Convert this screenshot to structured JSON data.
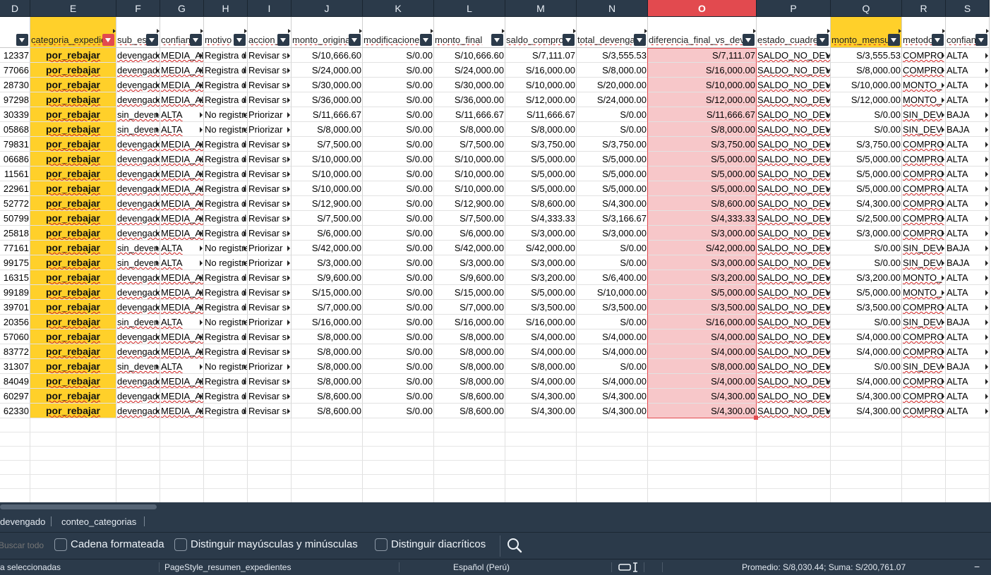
{
  "columns": [
    {
      "letter": "D",
      "header": "",
      "kind": "id",
      "selected": false,
      "highlight": ""
    },
    {
      "letter": "E",
      "header": "categoria_expediente",
      "kind": "cat",
      "selected": false,
      "highlight": "yellow",
      "filter_active": true
    },
    {
      "letter": "F",
      "header": "sub_estado",
      "kind": "text",
      "selected": false,
      "highlight": ""
    },
    {
      "letter": "G",
      "header": "confianza",
      "kind": "text",
      "selected": false,
      "highlight": ""
    },
    {
      "letter": "H",
      "header": "motivo",
      "kind": "text",
      "selected": false,
      "highlight": ""
    },
    {
      "letter": "I",
      "header": "accion_sugerida",
      "kind": "text",
      "selected": false,
      "highlight": ""
    },
    {
      "letter": "J",
      "header": "monto_original",
      "kind": "num",
      "selected": false,
      "highlight": ""
    },
    {
      "letter": "K",
      "header": "modificaciones",
      "kind": "num",
      "selected": false,
      "highlight": ""
    },
    {
      "letter": "L",
      "header": "monto_final",
      "kind": "num",
      "selected": false,
      "highlight": ""
    },
    {
      "letter": "M",
      "header": "saldo_comprometido",
      "kind": "num",
      "selected": false,
      "highlight": ""
    },
    {
      "letter": "N",
      "header": "total_devengado",
      "kind": "num",
      "selected": false,
      "highlight": ""
    },
    {
      "letter": "O",
      "header": "diferencia_final_vs_devengado",
      "kind": "num",
      "selected": true,
      "highlight": "pink"
    },
    {
      "letter": "P",
      "header": "estado_cuadre",
      "kind": "text",
      "selected": false,
      "highlight": ""
    },
    {
      "letter": "Q",
      "header": "monto_mensual",
      "kind": "num",
      "selected": false,
      "highlight": "yellow-header"
    },
    {
      "letter": "R",
      "header": "metodo",
      "kind": "text",
      "selected": false,
      "highlight": ""
    },
    {
      "letter": "S",
      "header": "confianza",
      "kind": "text",
      "selected": false,
      "highlight": ""
    }
  ],
  "rows": [
    [
      "12337",
      "por_rebajar",
      "devengado",
      "MEDIA_ALTA",
      "Registra d",
      "Revisar s",
      "S/10,666.60",
      "S/0.00",
      "S/10,666.60",
      "S/7,111.07",
      "S/3,555.53",
      "S/7,111.07",
      "SALDO_NO_DEV",
      "S/3,555.53",
      "COMPRO",
      "ALTA"
    ],
    [
      "77066",
      "por_rebajar",
      "devengado",
      "MEDIA_ALTA",
      "Registra d",
      "Revisar s",
      "S/24,000.00",
      "S/0.00",
      "S/24,000.00",
      "S/16,000.00",
      "S/8,000.00",
      "S/16,000.00",
      "SALDO_NO_DEV",
      "S/8,000.00",
      "COMPRO",
      "ALTA"
    ],
    [
      "28730",
      "por_rebajar",
      "devengado",
      "MEDIA_ALTA",
      "Registra d",
      "Revisar s",
      "S/30,000.00",
      "S/0.00",
      "S/30,000.00",
      "S/10,000.00",
      "S/20,000.00",
      "S/10,000.00",
      "SALDO_NO_DEV",
      "S/10,000.00",
      "MONTO_",
      "ALTA"
    ],
    [
      "97298",
      "por_rebajar",
      "devengado",
      "MEDIA_ALTA",
      "Registra d",
      "Revisar s",
      "S/36,000.00",
      "S/0.00",
      "S/36,000.00",
      "S/12,000.00",
      "S/24,000.00",
      "S/12,000.00",
      "SALDO_NO_DEV",
      "S/12,000.00",
      "MONTO_",
      "ALTA"
    ],
    [
      "30339",
      "por_rebajar",
      "sin_devengado",
      "ALTA",
      "No registra",
      "Priorizar",
      "S/11,666.67",
      "S/0.00",
      "S/11,666.67",
      "S/11,666.67",
      "S/0.00",
      "S/11,666.67",
      "SALDO_NO_DEV",
      "S/0.00",
      "SIN_DEV",
      "BAJA"
    ],
    [
      "05868",
      "por_rebajar",
      "sin_devengado",
      "ALTA",
      "No registra",
      "Priorizar",
      "S/8,000.00",
      "S/0.00",
      "S/8,000.00",
      "S/8,000.00",
      "S/0.00",
      "S/8,000.00",
      "SALDO_NO_DEV",
      "S/0.00",
      "SIN_DEV",
      "BAJA"
    ],
    [
      "79831",
      "por_rebajar",
      "devengado",
      "MEDIA_ALTA",
      "Registra d",
      "Revisar s",
      "S/7,500.00",
      "S/0.00",
      "S/7,500.00",
      "S/3,750.00",
      "S/3,750.00",
      "S/3,750.00",
      "SALDO_NO_DEV",
      "S/3,750.00",
      "COMPRO",
      "ALTA"
    ],
    [
      "06686",
      "por_rebajar",
      "devengado",
      "MEDIA_ALTA",
      "Registra d",
      "Revisar s",
      "S/10,000.00",
      "S/0.00",
      "S/10,000.00",
      "S/5,000.00",
      "S/5,000.00",
      "S/5,000.00",
      "SALDO_NO_DEV",
      "S/5,000.00",
      "COMPRO",
      "ALTA"
    ],
    [
      "11561",
      "por_rebajar",
      "devengado",
      "MEDIA_ALTA",
      "Registra d",
      "Revisar s",
      "S/10,000.00",
      "S/0.00",
      "S/10,000.00",
      "S/5,000.00",
      "S/5,000.00",
      "S/5,000.00",
      "SALDO_NO_DEV",
      "S/5,000.00",
      "COMPRO",
      "ALTA"
    ],
    [
      "22961",
      "por_rebajar",
      "devengado",
      "MEDIA_ALTA",
      "Registra d",
      "Revisar s",
      "S/10,000.00",
      "S/0.00",
      "S/10,000.00",
      "S/5,000.00",
      "S/5,000.00",
      "S/5,000.00",
      "SALDO_NO_DEV",
      "S/5,000.00",
      "COMPRO",
      "ALTA"
    ],
    [
      "52772",
      "por_rebajar",
      "devengado",
      "MEDIA_ALTA",
      "Registra d",
      "Revisar s",
      "S/12,900.00",
      "S/0.00",
      "S/12,900.00",
      "S/8,600.00",
      "S/4,300.00",
      "S/8,600.00",
      "SALDO_NO_DEV",
      "S/4,300.00",
      "COMPRO",
      "ALTA"
    ],
    [
      "50799",
      "por_rebajar",
      "devengado",
      "MEDIA_ALTA",
      "Registra d",
      "Revisar s",
      "S/7,500.00",
      "S/0.00",
      "S/7,500.00",
      "S/4,333.33",
      "S/3,166.67",
      "S/4,333.33",
      "SALDO_NO_DEV",
      "S/2,500.00",
      "COMPRO",
      "ALTA"
    ],
    [
      "25818",
      "por_rebajar",
      "devengado",
      "MEDIA_ALTA",
      "Registra d",
      "Revisar s",
      "S/6,000.00",
      "S/0.00",
      "S/6,000.00",
      "S/3,000.00",
      "S/3,000.00",
      "S/3,000.00",
      "SALDO_NO_DEV",
      "S/3,000.00",
      "COMPRO",
      "ALTA"
    ],
    [
      "77161",
      "por_rebajar",
      "sin_devengado",
      "ALTA",
      "No registra",
      "Priorizar",
      "S/42,000.00",
      "S/0.00",
      "S/42,000.00",
      "S/42,000.00",
      "S/0.00",
      "S/42,000.00",
      "SALDO_NO_DEV",
      "S/0.00",
      "SIN_DEV",
      "BAJA"
    ],
    [
      "99175",
      "por_rebajar",
      "sin_devengado",
      "ALTA",
      "No registra",
      "Priorizar",
      "S/3,000.00",
      "S/0.00",
      "S/3,000.00",
      "S/3,000.00",
      "S/0.00",
      "S/3,000.00",
      "SALDO_NO_DEV",
      "S/0.00",
      "SIN_DEV",
      "BAJA"
    ],
    [
      "16315",
      "por_rebajar",
      "devengado",
      "MEDIA_ALTA",
      "Registra d",
      "Revisar s",
      "S/9,600.00",
      "S/0.00",
      "S/9,600.00",
      "S/3,200.00",
      "S/6,400.00",
      "S/3,200.00",
      "SALDO_NO_DEV",
      "S/3,200.00",
      "MONTO_",
      "ALTA"
    ],
    [
      "99189",
      "por_rebajar",
      "devengado",
      "MEDIA_ALTA",
      "Registra d",
      "Revisar s",
      "S/15,000.00",
      "S/0.00",
      "S/15,000.00",
      "S/5,000.00",
      "S/10,000.00",
      "S/5,000.00",
      "SALDO_NO_DEV",
      "S/5,000.00",
      "MONTO_",
      "ALTA"
    ],
    [
      "39701",
      "por_rebajar",
      "devengado",
      "MEDIA_ALTA",
      "Registra d",
      "Revisar s",
      "S/7,000.00",
      "S/0.00",
      "S/7,000.00",
      "S/3,500.00",
      "S/3,500.00",
      "S/3,500.00",
      "SALDO_NO_DEV",
      "S/3,500.00",
      "COMPRO",
      "ALTA"
    ],
    [
      "20356",
      "por_rebajar",
      "sin_devengado",
      "ALTA",
      "No registra",
      "Priorizar",
      "S/16,000.00",
      "S/0.00",
      "S/16,000.00",
      "S/16,000.00",
      "S/0.00",
      "S/16,000.00",
      "SALDO_NO_DEV",
      "S/0.00",
      "SIN_DEV",
      "BAJA"
    ],
    [
      "57060",
      "por_rebajar",
      "devengado",
      "MEDIA_ALTA",
      "Registra d",
      "Revisar s",
      "S/8,000.00",
      "S/0.00",
      "S/8,000.00",
      "S/4,000.00",
      "S/4,000.00",
      "S/4,000.00",
      "SALDO_NO_DEV",
      "S/4,000.00",
      "COMPRO",
      "ALTA"
    ],
    [
      "83772",
      "por_rebajar",
      "devengado",
      "MEDIA_ALTA",
      "Registra d",
      "Revisar s",
      "S/8,000.00",
      "S/0.00",
      "S/8,000.00",
      "S/4,000.00",
      "S/4,000.00",
      "S/4,000.00",
      "SALDO_NO_DEV",
      "S/4,000.00",
      "COMPRO",
      "ALTA"
    ],
    [
      "31307",
      "por_rebajar",
      "sin_devengado",
      "ALTA",
      "No registra",
      "Priorizar",
      "S/8,000.00",
      "S/0.00",
      "S/8,000.00",
      "S/8,000.00",
      "S/0.00",
      "S/8,000.00",
      "SALDO_NO_DEV",
      "S/0.00",
      "SIN_DEV",
      "BAJA"
    ],
    [
      "84049",
      "por_rebajar",
      "devengado",
      "MEDIA_ALTA",
      "Registra d",
      "Revisar s",
      "S/8,000.00",
      "S/0.00",
      "S/8,000.00",
      "S/4,000.00",
      "S/4,000.00",
      "S/4,000.00",
      "SALDO_NO_DEV",
      "S/4,000.00",
      "COMPRO",
      "ALTA"
    ],
    [
      "60297",
      "por_rebajar",
      "devengado",
      "MEDIA_ALTA",
      "Registra d",
      "Revisar s",
      "S/8,600.00",
      "S/0.00",
      "S/8,600.00",
      "S/4,300.00",
      "S/4,300.00",
      "S/4,300.00",
      "SALDO_NO_DEV",
      "S/4,300.00",
      "COMPRO",
      "ALTA"
    ],
    [
      "62330",
      "por_rebajar",
      "devengado",
      "MEDIA_ALTA",
      "Registra d",
      "Revisar s",
      "S/8,600.00",
      "S/0.00",
      "S/8,600.00",
      "S/4,300.00",
      "S/4,300.00",
      "S/4,300.00",
      "SALDO_NO_DEV",
      "S/4,300.00",
      "COMPRO",
      "ALTA"
    ]
  ],
  "sheet_tabs": [
    "devengado",
    "conteo_categorias"
  ],
  "find_bar": {
    "search_placeholder": "Buscar todo",
    "opt_formatted": "Cadena formateada",
    "opt_case": "Distinguir mayúsculas y minúsculas",
    "opt_diacritics": "Distinguir diacríticos",
    "search_icon": "search-icon"
  },
  "status_bar": {
    "selection": "a seleccionadas",
    "page_style": "PageStyle_resumen_expedientes",
    "language": "Español (Perú)",
    "summary": "Promedio: S/8,030.44; Suma: S/200,761.07",
    "zoom_minus": "−"
  },
  "colors": {
    "chrome": "#2b3a4a",
    "selected_header": "#e24a4f",
    "category_fill": "#ffd02a",
    "selection_fill": "#f7c7c9"
  }
}
